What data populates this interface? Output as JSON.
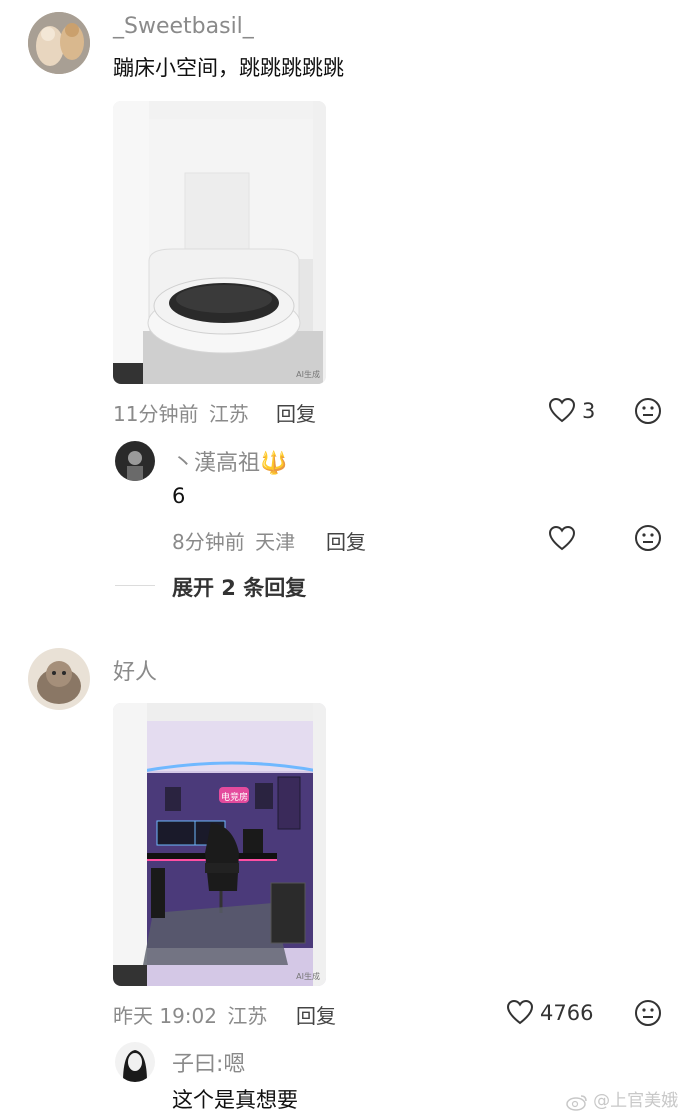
{
  "comments": [
    {
      "username": "_Sweetbasil_",
      "text": "蹦床小空间，跳跳跳跳跳",
      "time": "11分钟前",
      "location": "江苏",
      "reply_label": "回复",
      "likes": "3",
      "avatar_icon": "cat-avatar",
      "photo_subject": "trampoline-room-photo",
      "photo_caption": "AI生成"
    },
    {
      "username": "好人",
      "text": "",
      "time": "昨天 19:02",
      "location": "江苏",
      "reply_label": "回复",
      "likes": "4766",
      "avatar_icon": "cat-avatar",
      "photo_subject": "gaming-room-photo",
      "photo_caption": "AI生成",
      "sign_text": "电竞房"
    }
  ],
  "replies": [
    {
      "username": "丶漢高祖🔱",
      "text": "6",
      "time": "8分钟前",
      "location": "天津",
      "reply_label": "回复",
      "likes": ""
    },
    {
      "username": "子曰:嗯",
      "text": "这个是真想要"
    }
  ],
  "expand_label": "展开 2 条回复",
  "watermark": "@上官美娥",
  "colors": {
    "meta": "#8a8a8a",
    "accent_neon": "#ff4fa3",
    "led": "#6fb8ff"
  }
}
